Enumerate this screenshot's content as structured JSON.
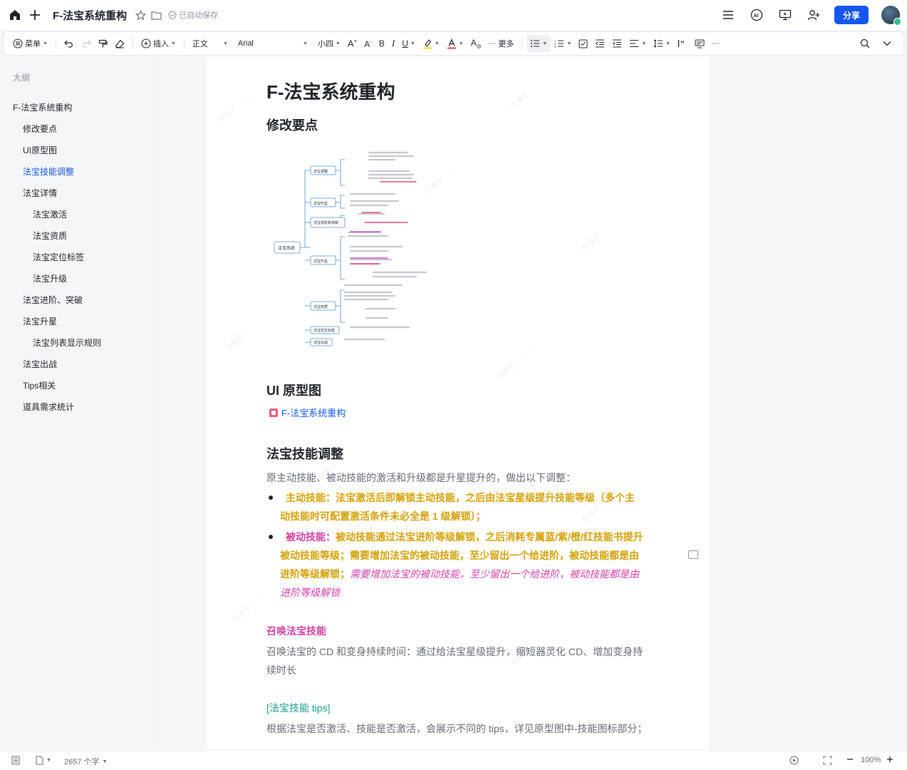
{
  "header": {
    "title": "F-法宝系统重构",
    "autosave": "已自动保存",
    "share_label": "分享"
  },
  "toolbar": {
    "menu": "菜单",
    "insert": "插入",
    "style": "正文",
    "font": "Arial",
    "size": "小四",
    "more": "更多"
  },
  "outline": {
    "heading": "大纲",
    "items": [
      {
        "label": "F-法宝系统重构"
      },
      {
        "label": "修改要点"
      },
      {
        "label": "UI原型图"
      },
      {
        "label": "法宝技能调整"
      },
      {
        "label": "法宝详情"
      },
      {
        "label": "法宝激活"
      },
      {
        "label": "法宝资质"
      },
      {
        "label": "法宝定位标签"
      },
      {
        "label": "法宝升级"
      },
      {
        "label": "法宝进阶、突破"
      },
      {
        "label": "法宝升星"
      },
      {
        "label": "法宝列表显示规则"
      },
      {
        "label": "法宝出战"
      },
      {
        "label": "Tips相关"
      },
      {
        "label": "道具需求统计"
      }
    ]
  },
  "doc": {
    "h1": "F-法宝系统重构",
    "h2_points": "修改要点",
    "h2_ui": "UI 原型图",
    "ui_link": "F-法宝系统重构",
    "h2_skill": "法宝技能调整",
    "skill_intro": "原主动技能、被动技能的激活和升级都是升星提升的，做出以下调整：",
    "b1_label": "主动技能：",
    "b1_line1": "法宝激活后即解锁主动技能，之后由法宝星级提升技能等级（多个主",
    "b1_line2": "动技能时可配置激活条件未必全是 1 级解锁）；",
    "b2_label": "被动技能：",
    "b2_line1": "被动技能通过法宝进阶等级解锁，之后消耗专属蓝/紫/橙/红技能书提升",
    "b2_line2": "被动技能等级；需要增加法宝的被动技能，至少留出一个给进阶，被动技能都是由",
    "b2_line3a": "进阶等级解锁；",
    "b2_line3b": "需要增加法宝的被动技能，至少留出一个给进阶，被动技能都是由",
    "b2_line4": "进阶等级解锁",
    "h3_summon": "召唤法宝技能",
    "summon_line1": "召唤法宝的 CD 和变身持续时间：通过给法宝星级提升，缩短器灵化 CD、增加变身持",
    "summon_line2": "续时长",
    "tips_link": "[法宝技能 tips]",
    "tips_text": "根据法宝是否激活、技能是否激活，会展示不同的 tips，详见原型图中-技能图标部分；"
  },
  "mindmap": {
    "root": "法宝系统",
    "nodes": [
      "法宝调整",
      "法宝升星",
      "法宝进阶和突破",
      "法宝升星",
      "法宝资质",
      "法宝定位标签",
      "法宝出战"
    ]
  },
  "status": {
    "word_count": "2657 个字",
    "zoom": "100%"
  },
  "colors": {
    "accent": "#1456f0",
    "gold": "#d4a106",
    "magenta": "#d23fa6",
    "teal": "#1a9b8c"
  }
}
